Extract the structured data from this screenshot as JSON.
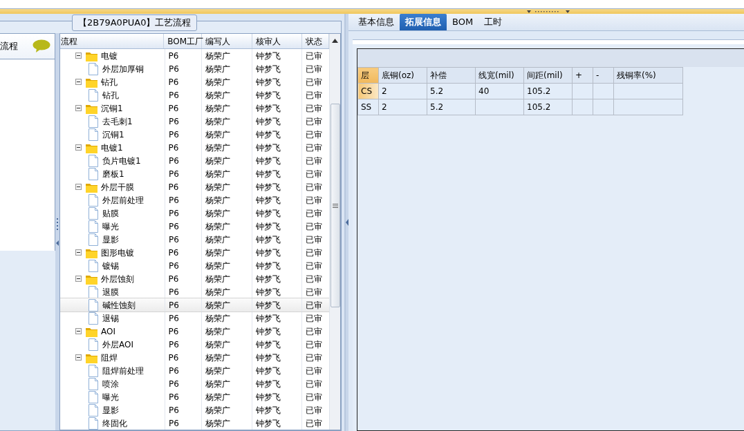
{
  "group_title": "【2B79A0PUA0】工艺流程",
  "side_panel": {
    "label": "流程"
  },
  "tree": {
    "columns": [
      "流程",
      "BOM工厂",
      "编写人",
      "核审人",
      "状态"
    ],
    "rows": [
      {
        "name": "电镀",
        "bom": "P6",
        "author": "杨荣广",
        "reviewer": "钟梦飞",
        "status": "已审",
        "expanded": true,
        "selected": false,
        "children": [
          {
            "name": "外层加厚铜",
            "bom": "P6",
            "author": "杨荣广",
            "reviewer": "钟梦飞",
            "status": "已审",
            "selected": false
          }
        ]
      },
      {
        "name": "钻孔",
        "bom": "P6",
        "author": "杨荣广",
        "reviewer": "钟梦飞",
        "status": "已审",
        "expanded": true,
        "selected": false,
        "children": [
          {
            "name": "钻孔",
            "bom": "P6",
            "author": "杨荣广",
            "reviewer": "钟梦飞",
            "status": "已审",
            "selected": false
          }
        ]
      },
      {
        "name": "沉铜1",
        "bom": "P6",
        "author": "杨荣广",
        "reviewer": "钟梦飞",
        "status": "已审",
        "expanded": true,
        "selected": false,
        "children": [
          {
            "name": "去毛刺1",
            "bom": "P6",
            "author": "杨荣广",
            "reviewer": "钟梦飞",
            "status": "已审",
            "selected": false
          },
          {
            "name": "沉铜1",
            "bom": "P6",
            "author": "杨荣广",
            "reviewer": "钟梦飞",
            "status": "已审",
            "selected": false
          }
        ]
      },
      {
        "name": "电镀1",
        "bom": "P6",
        "author": "杨荣广",
        "reviewer": "钟梦飞",
        "status": "已审",
        "expanded": true,
        "selected": false,
        "children": [
          {
            "name": "负片电镀1",
            "bom": "P6",
            "author": "杨荣广",
            "reviewer": "钟梦飞",
            "status": "已审",
            "selected": false
          },
          {
            "name": "磨板1",
            "bom": "P6",
            "author": "杨荣广",
            "reviewer": "钟梦飞",
            "status": "已审",
            "selected": false
          }
        ]
      },
      {
        "name": "外层干膜",
        "bom": "P6",
        "author": "杨荣广",
        "reviewer": "钟梦飞",
        "status": "已审",
        "expanded": true,
        "selected": false,
        "children": [
          {
            "name": "外层前处理",
            "bom": "P6",
            "author": "杨荣广",
            "reviewer": "钟梦飞",
            "status": "已审",
            "selected": false
          },
          {
            "name": "贴膜",
            "bom": "P6",
            "author": "杨荣广",
            "reviewer": "钟梦飞",
            "status": "已审",
            "selected": false
          },
          {
            "name": "曝光",
            "bom": "P6",
            "author": "杨荣广",
            "reviewer": "钟梦飞",
            "status": "已审",
            "selected": false
          },
          {
            "name": "显影",
            "bom": "P6",
            "author": "杨荣广",
            "reviewer": "钟梦飞",
            "status": "已审",
            "selected": false
          }
        ]
      },
      {
        "name": "图形电镀",
        "bom": "P6",
        "author": "杨荣广",
        "reviewer": "钟梦飞",
        "status": "已审",
        "expanded": true,
        "selected": false,
        "children": [
          {
            "name": "镀锡",
            "bom": "P6",
            "author": "杨荣广",
            "reviewer": "钟梦飞",
            "status": "已审",
            "selected": false
          }
        ]
      },
      {
        "name": "外层蚀刻",
        "bom": "P6",
        "author": "杨荣广",
        "reviewer": "钟梦飞",
        "status": "已审",
        "expanded": true,
        "selected": false,
        "children": [
          {
            "name": "退膜",
            "bom": "P6",
            "author": "杨荣广",
            "reviewer": "钟梦飞",
            "status": "已审",
            "selected": false
          },
          {
            "name": "碱性蚀刻",
            "bom": "P6",
            "author": "杨荣广",
            "reviewer": "钟梦飞",
            "status": "已审",
            "selected": true
          },
          {
            "name": "退锡",
            "bom": "P6",
            "author": "杨荣广",
            "reviewer": "钟梦飞",
            "status": "已审",
            "selected": false
          }
        ]
      },
      {
        "name": "AOI",
        "bom": "P6",
        "author": "杨荣广",
        "reviewer": "钟梦飞",
        "status": "已审",
        "expanded": true,
        "selected": false,
        "children": [
          {
            "name": "外层AOI",
            "bom": "P6",
            "author": "杨荣广",
            "reviewer": "钟梦飞",
            "status": "已审",
            "selected": false
          }
        ]
      },
      {
        "name": "阻焊",
        "bom": "P6",
        "author": "杨荣广",
        "reviewer": "钟梦飞",
        "status": "已审",
        "expanded": true,
        "selected": false,
        "children": [
          {
            "name": "阻焊前处理",
            "bom": "P6",
            "author": "杨荣广",
            "reviewer": "钟梦飞",
            "status": "已审",
            "selected": false
          },
          {
            "name": "喷涂",
            "bom": "P6",
            "author": "杨荣广",
            "reviewer": "钟梦飞",
            "status": "已审",
            "selected": false
          },
          {
            "name": "曝光",
            "bom": "P6",
            "author": "杨荣广",
            "reviewer": "钟梦飞",
            "status": "已审",
            "selected": false
          },
          {
            "name": "显影",
            "bom": "P6",
            "author": "杨荣广",
            "reviewer": "钟梦飞",
            "status": "已审",
            "selected": false
          },
          {
            "name": "终固化",
            "bom": "P6",
            "author": "杨荣广",
            "reviewer": "钟梦飞",
            "status": "已审",
            "selected": false
          }
        ]
      }
    ]
  },
  "tabs": [
    {
      "label": "基本信息",
      "selected": false
    },
    {
      "label": "拓展信息",
      "selected": true
    },
    {
      "label": "BOM",
      "selected": false
    },
    {
      "label": "工时",
      "selected": false
    }
  ],
  "layer_table": {
    "columns": [
      "层",
      "底铜(oz)",
      "补偿",
      "线宽(mil)",
      "间距(mil)",
      "+",
      "-",
      "残铜率(%)"
    ],
    "rows": [
      {
        "cells": [
          "CS",
          "2",
          "5.2",
          "40",
          "105.2",
          "",
          "",
          ""
        ],
        "selected": true
      },
      {
        "cells": [
          "SS",
          "2",
          "5.2",
          "",
          "105.2",
          "",
          "",
          ""
        ],
        "selected": false
      }
    ]
  }
}
